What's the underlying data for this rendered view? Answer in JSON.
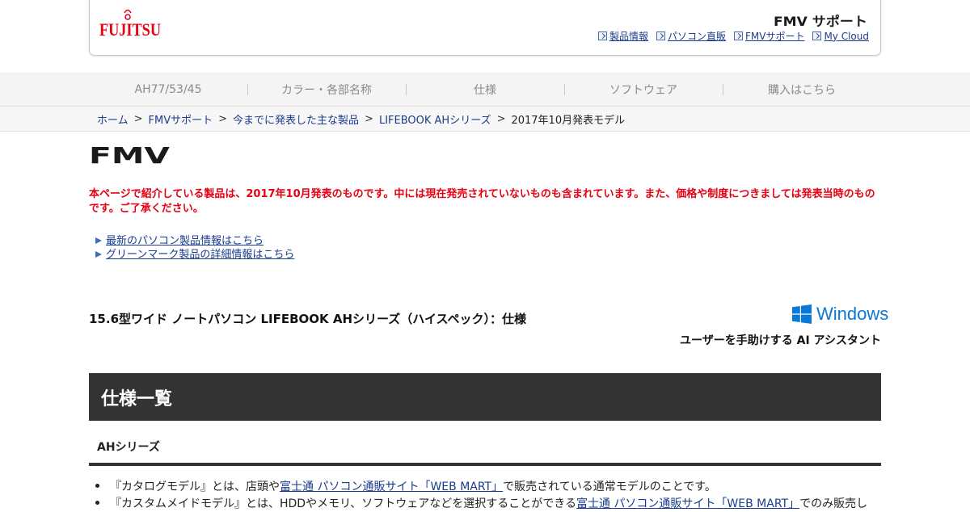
{
  "header": {
    "brand_logo_text": "FUJITSU",
    "support_logo_text": "FMV サポート",
    "links": [
      {
        "label": "製品情報",
        "icon": "arrow-box-icon"
      },
      {
        "label": "パソコン直販",
        "icon": "arrow-box-icon"
      },
      {
        "label": "FMVサポート",
        "icon": "arrow-box-icon"
      },
      {
        "label": "My Cloud",
        "icon": "arrow-box-icon"
      }
    ]
  },
  "nav": {
    "tabs": [
      {
        "label": "AH77/53/45"
      },
      {
        "label": "カラー・各部名称"
      },
      {
        "label": "仕様"
      },
      {
        "label": "ソフトウェア"
      },
      {
        "label": "購入はこちら"
      }
    ]
  },
  "breadcrumb": {
    "items": [
      "ホーム",
      "FMVサポート",
      "今までに発表した主な製品",
      "LIFEBOOK AHシリーズ"
    ],
    "separator": ">",
    "current": "2017年10月発表モデル"
  },
  "fmv_logo_text": "FMV",
  "notice": "本ページで紹介している製品は、2017年10月発表のものです。中には現在発売されていないものも含まれています。また、価格や制度につきましては発表当時のものです。ご了承ください。",
  "info_links": [
    {
      "label": "最新のパソコン製品情報はこちら"
    },
    {
      "label": "グリーンマーク製品の詳細情報はこちら"
    }
  ],
  "product": {
    "title": "15.6型ワイド ノートパソコン LIFEBOOK AHシリーズ（ハイスペック）：仕様",
    "windows_label": "Windows",
    "tagline": "ユーザーを手助けする AI アシスタント"
  },
  "spec": {
    "heading": "仕様一覧",
    "series_label": "AHシリーズ"
  },
  "bullets": [
    {
      "pre": "『カタログモデル』とは、店頭や",
      "link": "富士通 パソコン通販サイト「WEB MART」",
      "post": "で販売されている通常モデルのことです。"
    },
    {
      "pre": "『カスタムメイドモデル』とは、HDDやメモリ、ソフトウェアなどを選択することができる",
      "link": "富士通 パソコン通販サイト「WEB MART」",
      "post": "でのみ販売し"
    }
  ],
  "colors": {
    "notice_red": "#e60012",
    "link_blue": "#1a3c8c",
    "heading_bg": "#333333",
    "fujitsu_red": "#e60012",
    "support_green": "#1e8a3c",
    "windows_blue": "#0a78d7"
  }
}
